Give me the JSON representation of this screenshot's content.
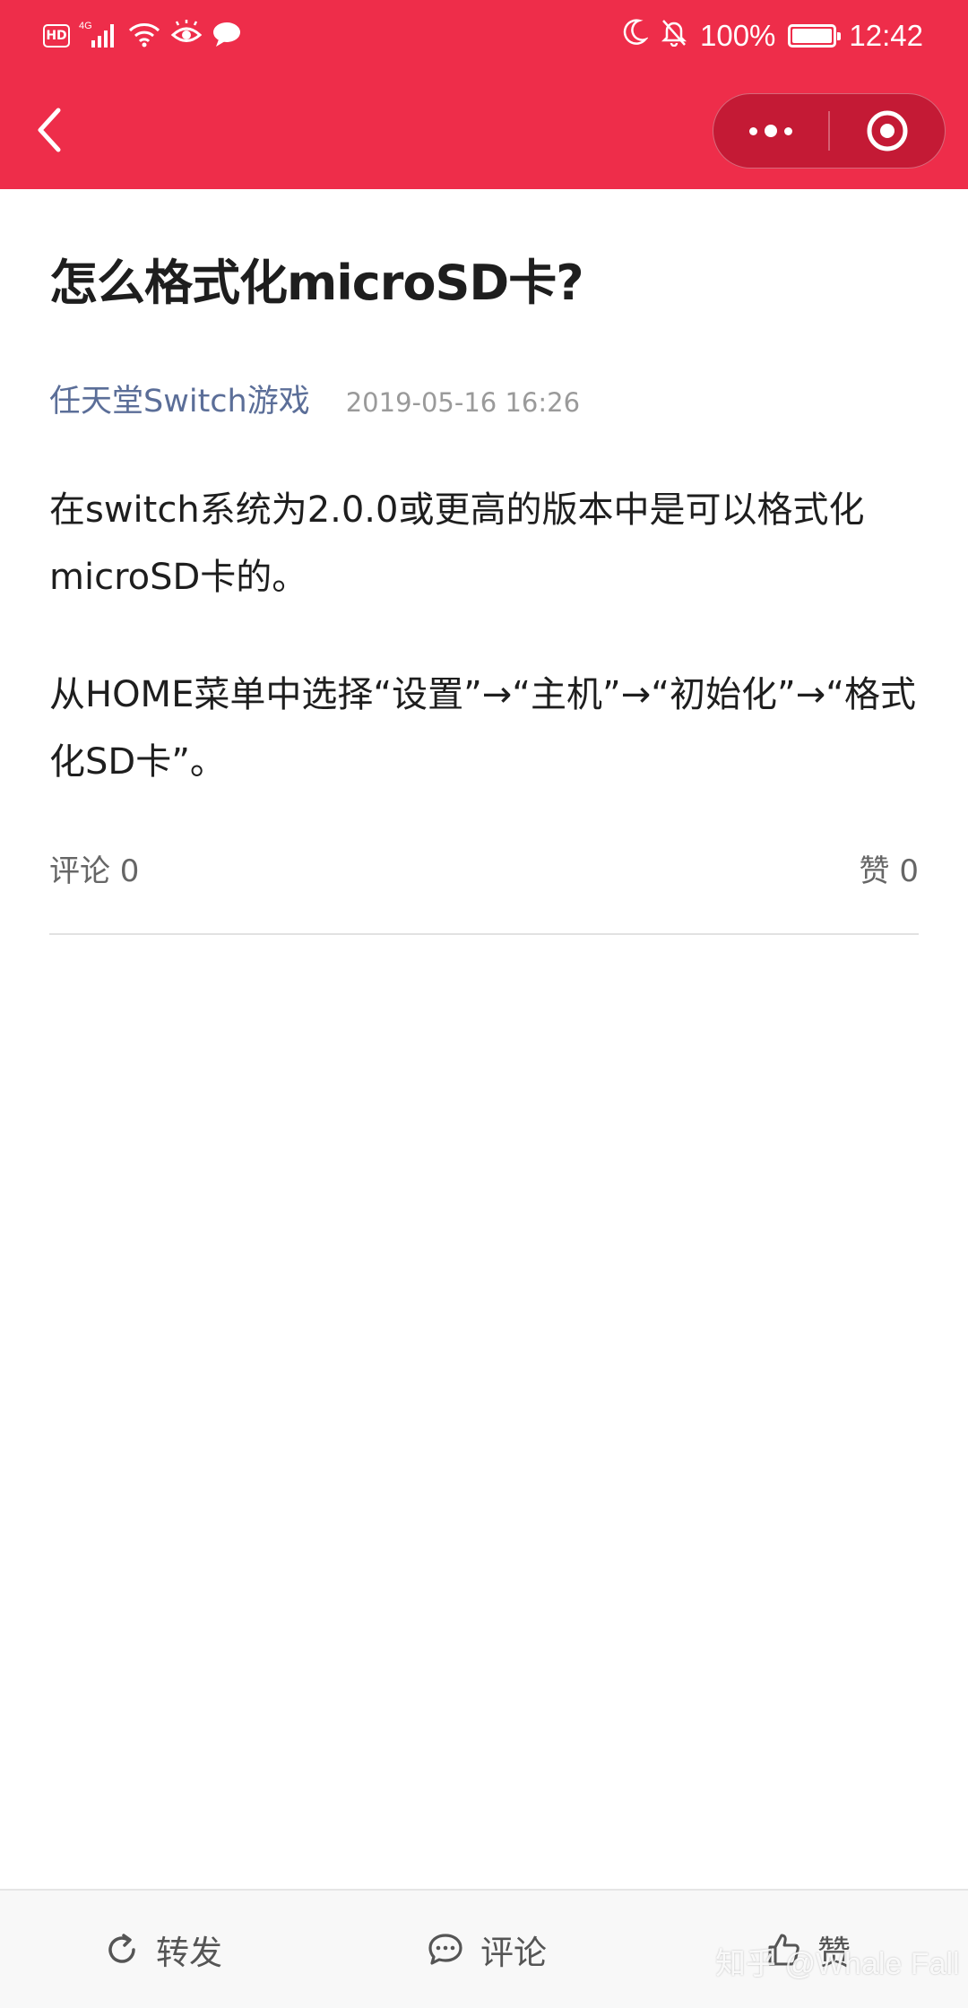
{
  "status_bar": {
    "hd_badge": "HD",
    "network": "4G",
    "battery_percent": "100%",
    "battery_level": 1.0,
    "time": "12:42",
    "icons": [
      "hd-icon",
      "signal-4g-icon",
      "wifi-icon",
      "eye-icon",
      "message-icon",
      "moon-icon",
      "bell-off-icon",
      "battery-icon"
    ]
  },
  "nav": {
    "back_icon": "chevron-left-icon",
    "more_icon": "more-dots-icon",
    "close_icon": "target-close-icon",
    "accent_color": "#ee2d4a"
  },
  "article": {
    "title": "怎么格式化microSD卡?",
    "author": "任天堂Switch游戏",
    "date": "2019-05-16 16:26",
    "paragraphs": [
      "在switch系统为2.0.0或更高的版本中是可以格式化microSD卡的。",
      "从HOME菜单中选择“设置”→“主机”→“初始化”→“格式化SD卡”。"
    ],
    "comments_label": "评论 0",
    "likes_label": "赞 0"
  },
  "bottom_bar": {
    "share_label": "转发",
    "comment_label": "评论",
    "like_label": "赞",
    "icons": [
      "share-icon",
      "comment-icon",
      "thumbs-up-icon"
    ]
  },
  "watermark": "知乎 @Whale Fall"
}
